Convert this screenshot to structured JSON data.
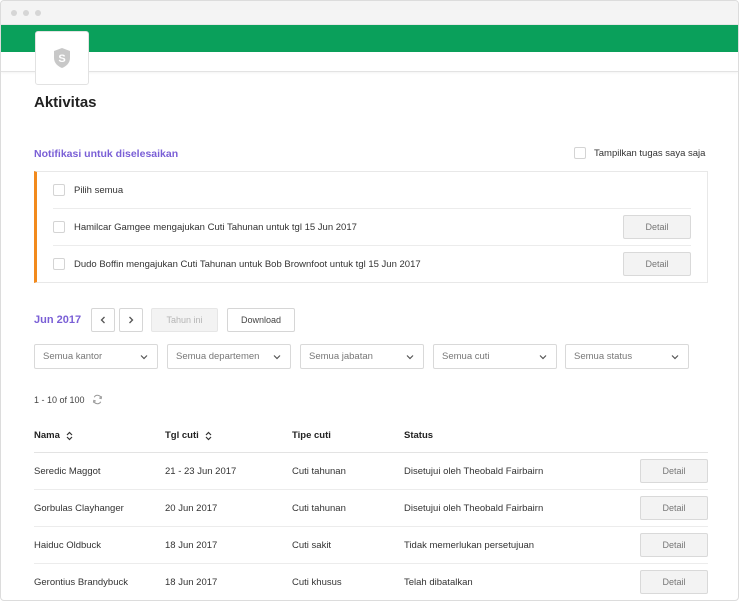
{
  "header": {
    "brand_color": "#0aa05b"
  },
  "page": {
    "title": "Aktivitas"
  },
  "notifications": {
    "title": "Notifikasi untuk diselesaikan",
    "my_tasks_label": "Tampilkan tugas saya saja",
    "select_all_label": "Pilih semua",
    "items": [
      {
        "text": "Hamilcar Gamgee mengajukan Cuti Tahunan untuk tgl 15 Jun 2017",
        "button": "Detail"
      },
      {
        "text": "Dudo Boffin mengajukan Cuti Tahunan untuk Bob Brownfoot untuk tgl 15 Jun 2017",
        "button": "Detail"
      }
    ]
  },
  "period": {
    "month": "Jun 2017",
    "this_year_label": "Tahun ini",
    "download_label": "Download"
  },
  "filters": [
    {
      "label": "Semua kantor"
    },
    {
      "label": "Semua departemen"
    },
    {
      "label": "Semua jabatan"
    },
    {
      "label": "Semua cuti"
    },
    {
      "label": "Semua status"
    }
  ],
  "pagination": {
    "text": "1 - 10 of 100"
  },
  "table": {
    "columns": {
      "name": "Nama",
      "date": "Tgl cuti",
      "type": "Tipe cuti",
      "status": "Status"
    },
    "rows": [
      {
        "name": "Seredic Maggot",
        "date": "21 - 23 Jun 2017",
        "type": "Cuti tahunan",
        "status": "Disetujui oleh Theobald Fairbairn",
        "button": "Detail"
      },
      {
        "name": "Gorbulas Clayhanger",
        "date": "20 Jun 2017",
        "type": "Cuti tahunan",
        "status": "Disetujui oleh Theobald Fairbairn",
        "button": "Detail"
      },
      {
        "name": "Haiduc Oldbuck",
        "date": "18 Jun 2017",
        "type": "Cuti sakit",
        "status": "Tidak memerlukan persetujuan",
        "button": "Detail"
      },
      {
        "name": "Gerontius Brandybuck",
        "date": "18 Jun 2017",
        "type": "Cuti khusus",
        "status": "Telah dibatalkan",
        "button": "Detail"
      }
    ]
  },
  "colors": {
    "accent": "#7a5fd6",
    "notification_border": "#f28a1d",
    "brand": "#0aa05b"
  }
}
